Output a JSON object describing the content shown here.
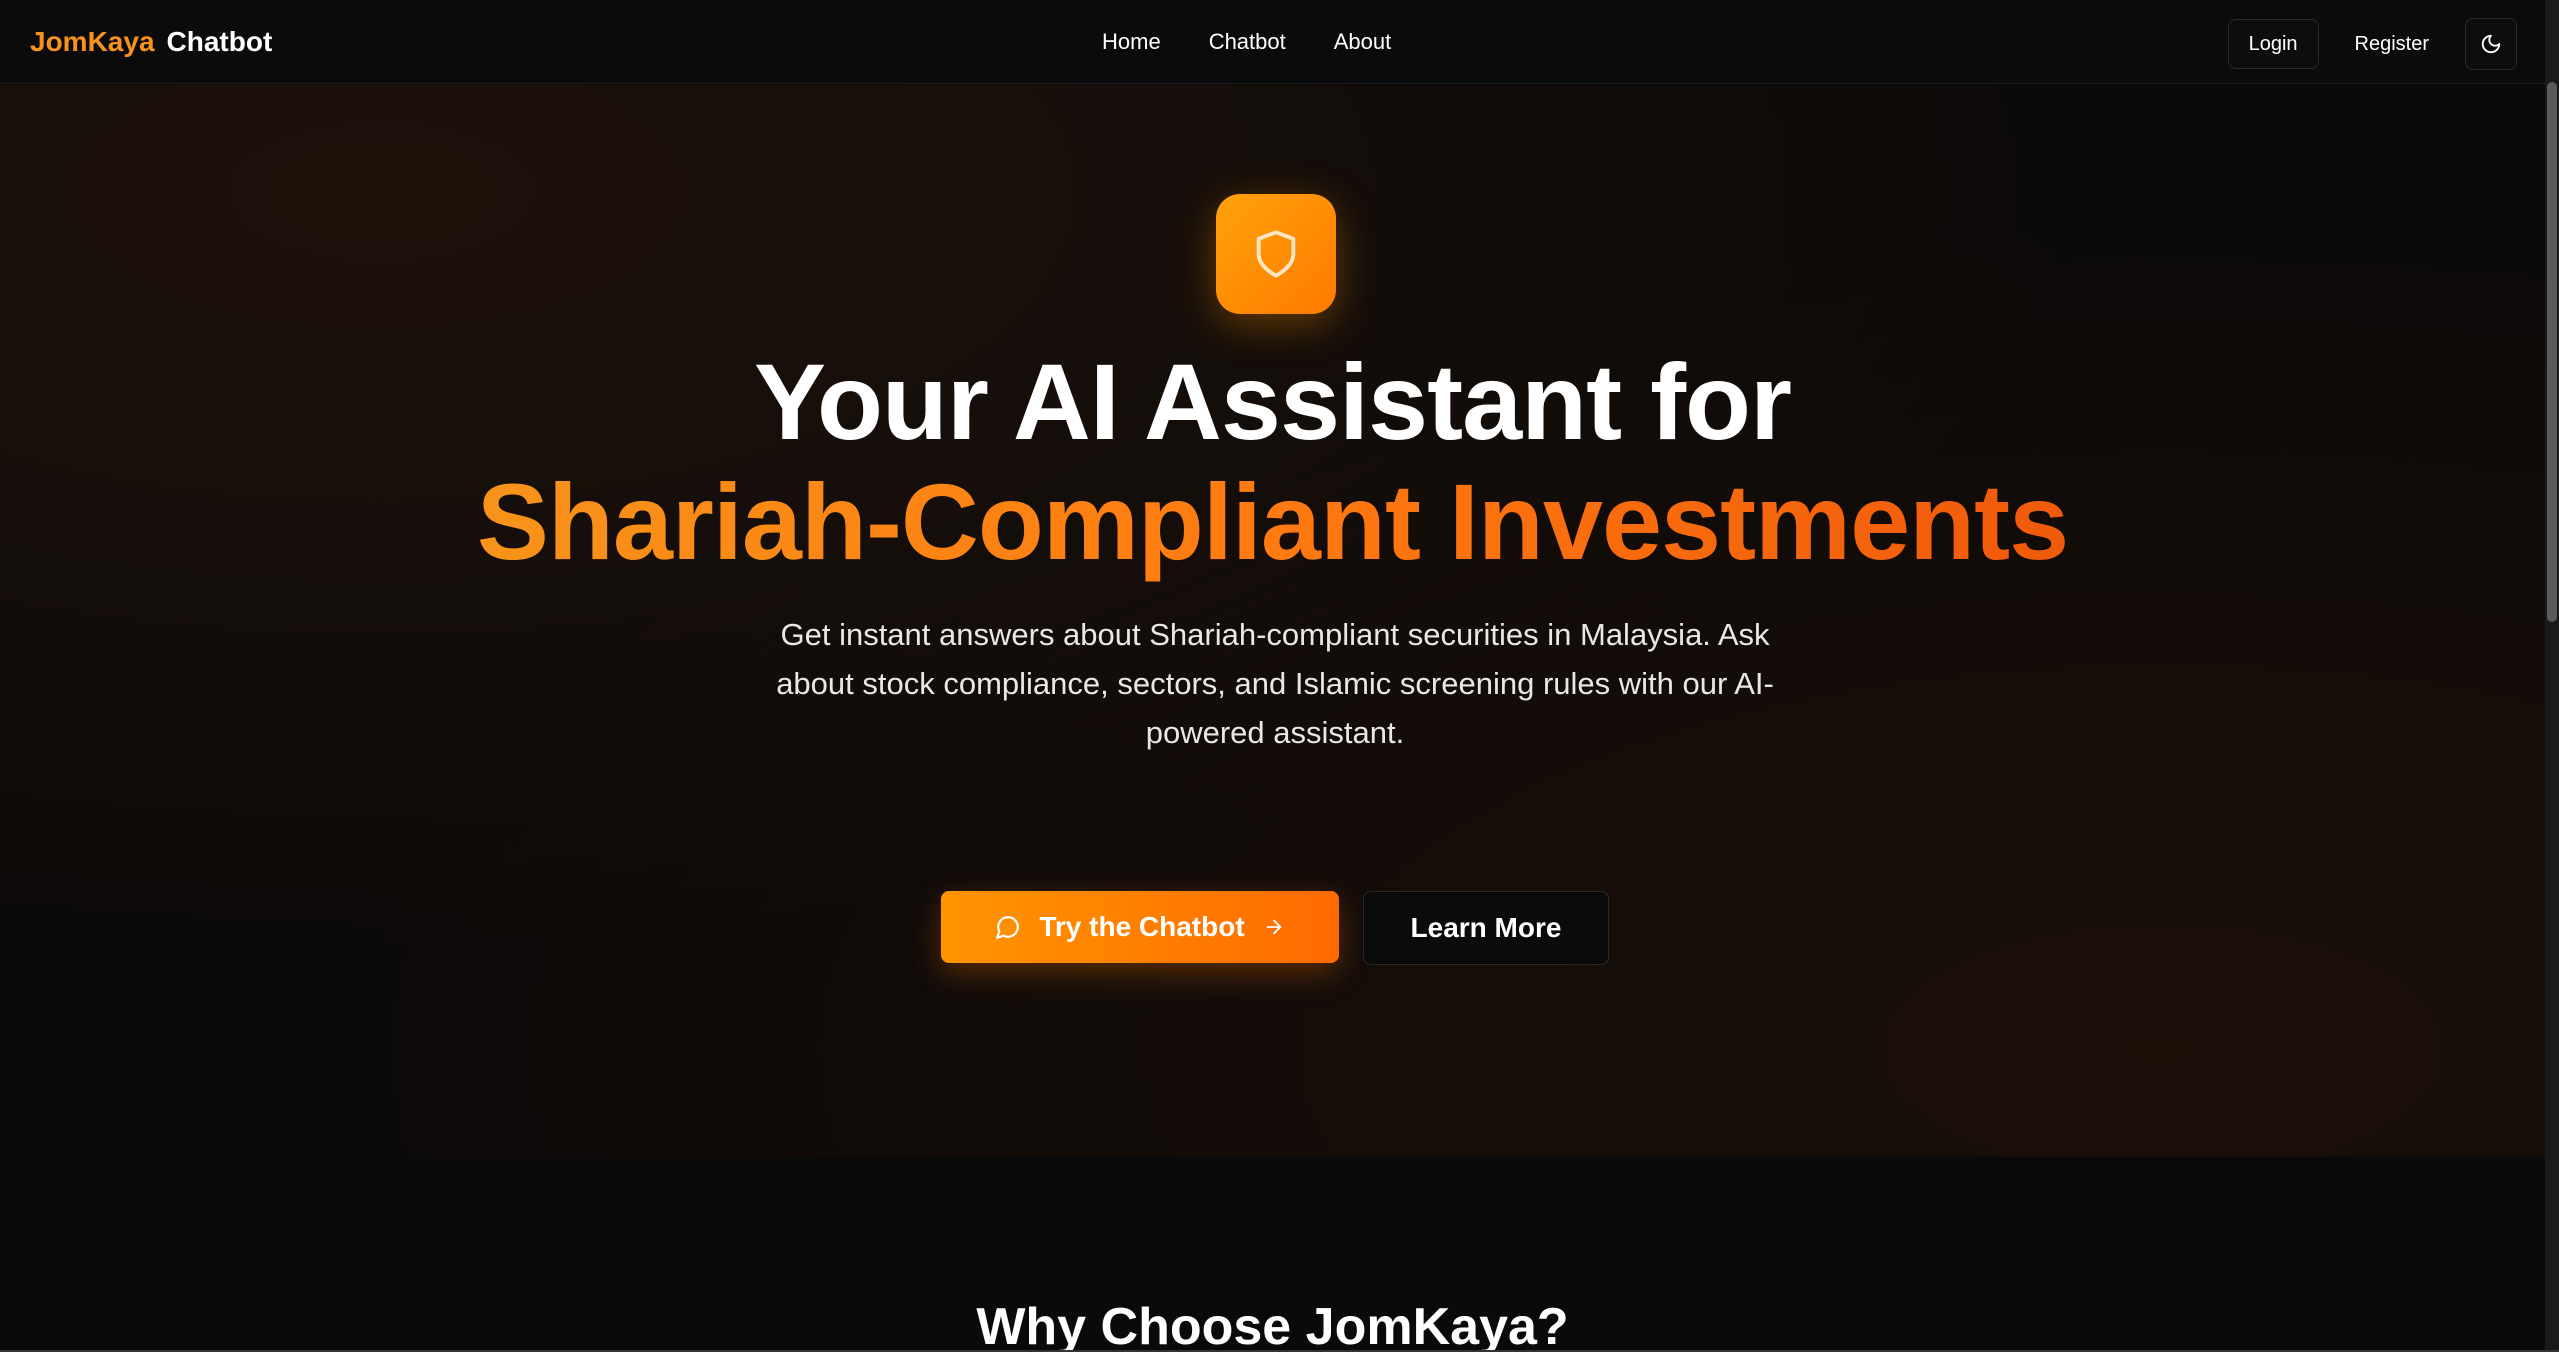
{
  "nav": {
    "brand_primary": "JomKaya",
    "brand_secondary": "Chatbot",
    "links": [
      "Home",
      "Chatbot",
      "About"
    ],
    "login": "Login",
    "register": "Register",
    "theme_icon": "moon-icon"
  },
  "hero": {
    "icon": "shield-icon",
    "headline_line1": "Your AI Assistant for",
    "headline_line2": "Shariah-Compliant Investments",
    "subtext": "Get instant answers about Shariah-compliant securities in Malaysia. Ask about stock compliance, sectors, and Islamic screening rules with our AI-powered assistant.",
    "primary_cta": "Try the Chatbot",
    "secondary_cta": "Learn More"
  },
  "section": {
    "title": "Why Choose JomKaya?"
  },
  "colors": {
    "accent": "#f7931a",
    "accent_dark": "#ff6a00",
    "background": "#0a0a0a"
  }
}
